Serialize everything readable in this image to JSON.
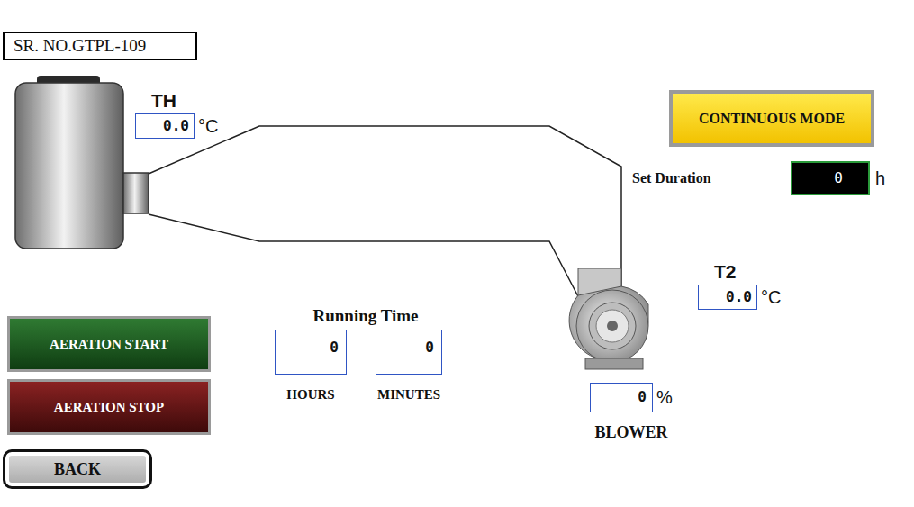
{
  "serial": "SR. NO.GTPL-109",
  "sensors": [
    {
      "label": "TH",
      "value": "0.0",
      "unit": "°C"
    },
    {
      "label": "T2",
      "value": "0.0",
      "unit": "°C"
    }
  ],
  "mode": {
    "label": "CONTINUOUS MODE"
  },
  "set_duration": {
    "label": "Set Duration",
    "value": "0",
    "unit": "h"
  },
  "running_time": {
    "title": "Running Time",
    "fields": [
      {
        "label": "HOURS",
        "value": "0"
      },
      {
        "label": "MINUTES",
        "value": "0"
      }
    ]
  },
  "blower": {
    "label": "BLOWER",
    "value": "0",
    "unit": "%"
  },
  "buttons": [
    {
      "label": "AERATION START",
      "kind": "start"
    },
    {
      "label": "AERATION STOP",
      "kind": "stop"
    }
  ],
  "back": "BACK"
}
